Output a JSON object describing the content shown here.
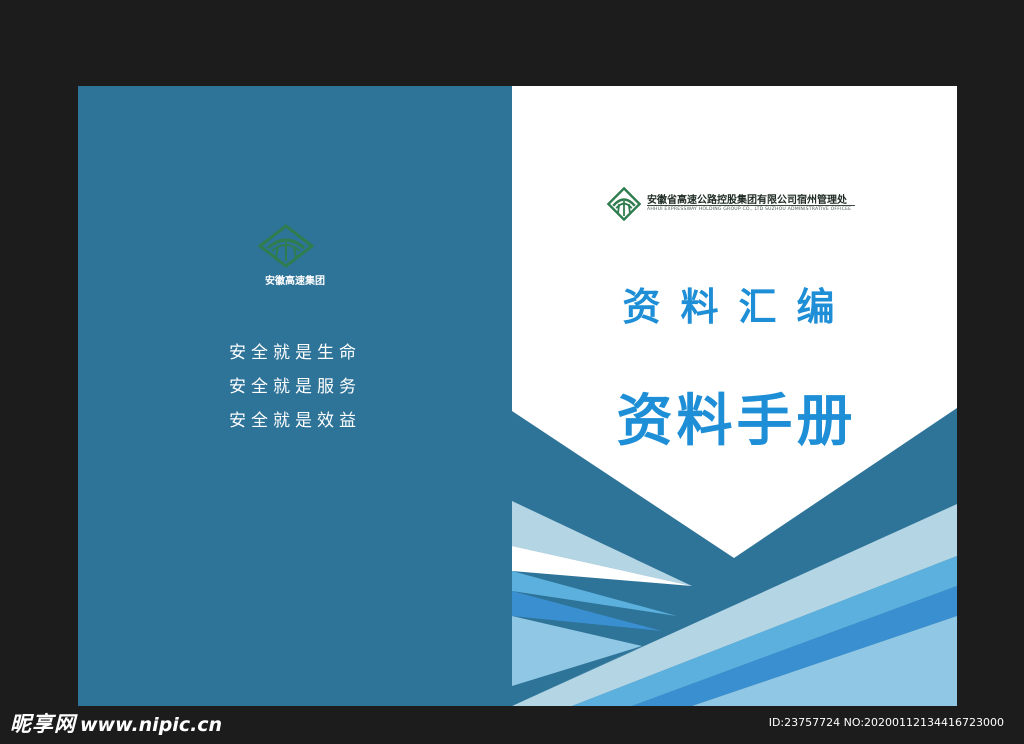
{
  "back_cover": {
    "brand_name": "安徽高速集团",
    "slogans": [
      "安全就是生命",
      "安全就是服务",
      "安全就是效益"
    ],
    "logo_icon": "highway-bridge-logo-icon"
  },
  "front_cover": {
    "company_name": "安徽省高速公路控股集团有限公司宿州管理处",
    "company_name_en": "AHHUI EXPRESSWAY HOLDING GROUP CO., LTD SUZHOU ADMINISTRATIVE OFFICEE",
    "subtitle": "资料汇编",
    "title": "资料手册",
    "logo_icon": "highway-bridge-logo-icon"
  },
  "watermark": {
    "site_name": "昵享网",
    "site_url": "www.nipic.cn",
    "image_id": "ID:23757724 NO:20200112134416723000"
  },
  "colors": {
    "background": "#1c1c1c",
    "back_cover": "#2e7398",
    "title_blue": "#1e8ed6",
    "logo_green": "#2f7d4e",
    "wave_dark": "#2e7398",
    "wave_pale": "#b3d5e4",
    "wave_mid": "#5bb0de",
    "wave_deep": "#3a8fd0",
    "wave_light": "#8fc7e4"
  }
}
